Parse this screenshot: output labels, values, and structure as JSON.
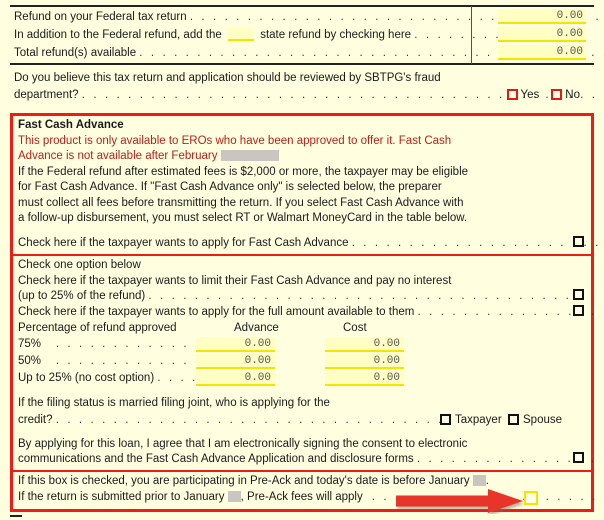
{
  "refund_section": {
    "rows": [
      {
        "label": "Refund on your Federal tax return",
        "value": "0.00"
      },
      {
        "label_pre": "In addition to the Federal refund,  add the",
        "label_post": "state refund by checking here",
        "value": "0.00",
        "checkbox": "unchecked"
      },
      {
        "label": "Total refund(s) available",
        "value": "0.00"
      }
    ]
  },
  "fraud_question": {
    "line1": "Do you believe this tax return and application should be reviewed by SBTPG's fraud",
    "line2": "department?",
    "yes_label": "Yes",
    "no_label": "No"
  },
  "fast_cash_advance": {
    "title": "Fast Cash Advance",
    "red_line1": "This product is only available to EROs who have been approved to offer it.  Fast Cash",
    "red_line2_pre": "Advance is not available after February",
    "body": [
      "If the Federal refund after estimated fees is $2,000 or more,  the taxpayer may be eligible",
      "for Fast Cash Advance.  If  \"Fast Cash Advance only\"  is selected below, the preparer",
      "must collect all fees before transmitting the return.  If you select Fast Cash Advance with",
      "a follow-up disbursement,  you must select RT or Walmart MoneyCard in the table below."
    ],
    "apply_line": "Check here if the taxpayer wants to apply for Fast Cash Advance"
  },
  "options_section": {
    "heading": "Check one option below",
    "limit_line1": "Check here if the taxpayer wants to limit their Fast Cash Advance and pay no interest",
    "limit_line2": "(up to 25%  of the refund)",
    "full_line": "Check here if the taxpayer wants to apply for the full amount available to them",
    "table": {
      "row_header": "Percentage of refund approved",
      "col_advance": "Advance",
      "col_cost": "Cost",
      "rows": [
        {
          "label": "75%",
          "advance": "0.00",
          "cost": "0.00"
        },
        {
          "label": "50%",
          "advance": "0.00",
          "cost": "0.00"
        },
        {
          "label": "Up to 25%  (no cost option)",
          "advance": "0.00",
          "cost": "0.00"
        }
      ]
    },
    "mfj_line1": "If the filing status is married filing joint,  who is applying for the",
    "mfj_line2": "credit?",
    "taxpayer_label": "Taxpayer",
    "spouse_label": "Spouse",
    "consent_line1": "By applying for this loan,  I agree that I am electronically signing the consent to electronic",
    "consent_line2": "communications and the Fast Cash Advance Application and disclosure forms"
  },
  "preack_section": {
    "line1_pre": "If this box is checked,  you are participating in Pre-Ack and today's date is before January",
    "line1_post": ".",
    "line2_pre": "If the return is submitted prior to January",
    "line2_post": ",  Pre-Ack fees will apply"
  },
  "colors": {
    "page_background": "#FFFFE0",
    "red_border": "#ED1C16",
    "red_text": "#B2231B",
    "field_background": "#FFFFC4",
    "field_underline": "#F2E500",
    "arrow": "#E8342B",
    "redaction": "#C9C6C1"
  }
}
